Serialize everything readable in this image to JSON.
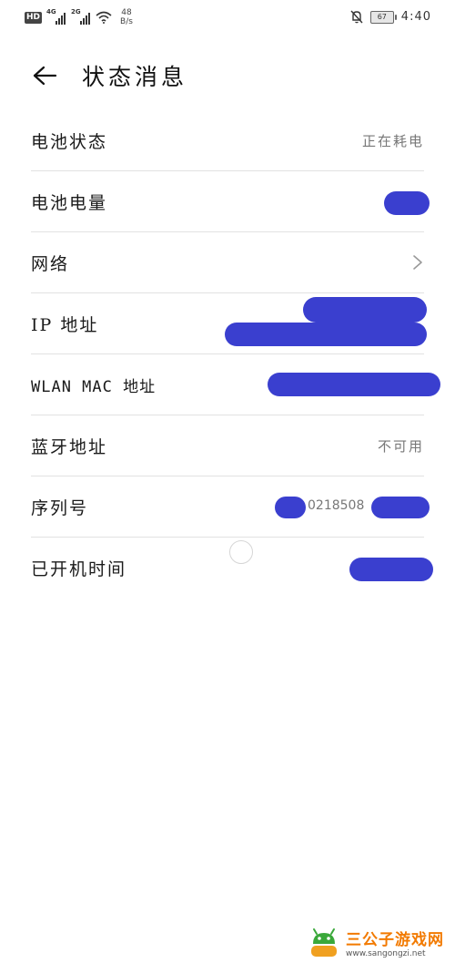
{
  "status_bar": {
    "hd_badge": "HD",
    "network_1": "4G",
    "network_2": "2G",
    "speed_value": "48",
    "speed_unit": "B/s",
    "battery_level": "67",
    "time": "4:40"
  },
  "header": {
    "title": "状态消息"
  },
  "rows": [
    {
      "label": "电池状态",
      "value": "正在耗电"
    },
    {
      "label": "电池电量",
      "value": ""
    },
    {
      "label": "网络",
      "value": ""
    },
    {
      "label": "IP 地址",
      "value": ""
    },
    {
      "label": "WLAN MAC 地址",
      "value": ""
    },
    {
      "label": "蓝牙地址",
      "value": "不可用"
    },
    {
      "label": "序列号",
      "value": "0218508"
    },
    {
      "label": "已开机时间",
      "value": ""
    }
  ],
  "watermark": {
    "name": "三公子游戏网",
    "url": "www.sangongzi.net"
  },
  "colors": {
    "redaction": "#3a3fcf",
    "watermark_orange": "#f27a00"
  }
}
